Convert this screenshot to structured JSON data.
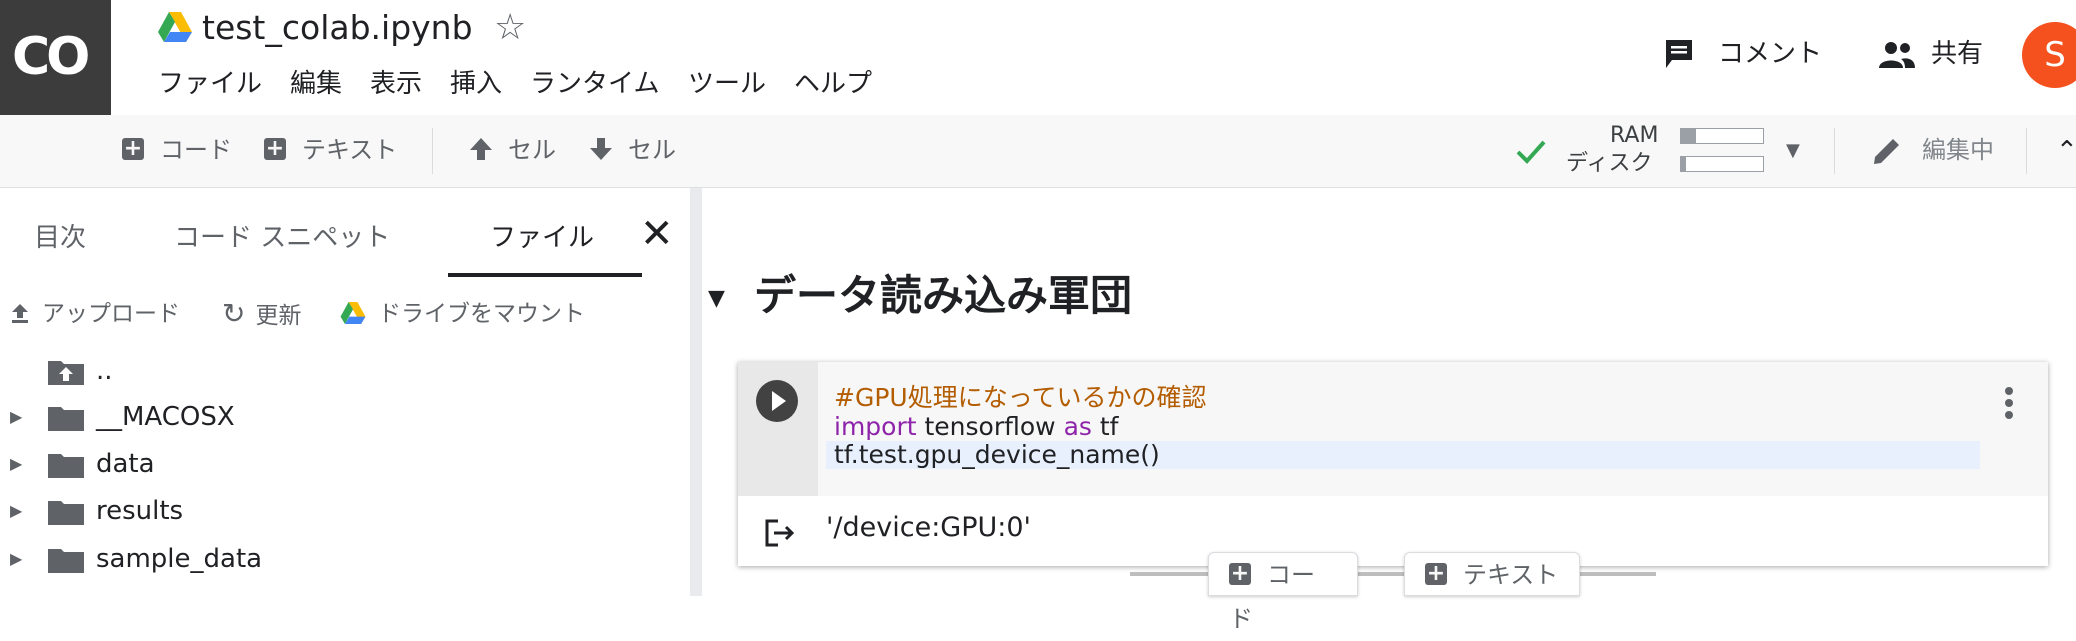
{
  "app": {
    "logo_text": "CO",
    "doc_title": "test_colab.ipynb",
    "star_icon": "star-outline-icon",
    "avatar_initial": "S",
    "avatar_color": "#f4511e"
  },
  "menu": [
    "ファイル",
    "編集",
    "表示",
    "挿入",
    "ランタイム",
    "ツール",
    "ヘルプ"
  ],
  "header_actions": {
    "comment": "コメント",
    "share": "共有"
  },
  "toolbar": {
    "add_code": "コード",
    "add_text": "テキスト",
    "cell_up": "セル",
    "cell_down": "セル",
    "ram_label": "RAM",
    "disk_label": "ディスク",
    "ram_usage": 0.18,
    "disk_usage": 0.06,
    "editing_label": "編集中"
  },
  "sidebar": {
    "tabs": [
      "目次",
      "コード スニペット",
      "ファイル"
    ],
    "active_tab": "ファイル",
    "actions": {
      "upload": "アップロード",
      "refresh": "更新",
      "mount_drive": "ドライブをマウント"
    },
    "files": [
      {
        "name": "..",
        "type": "parent"
      },
      {
        "name": "__MACOSX",
        "type": "folder"
      },
      {
        "name": "data",
        "type": "folder"
      },
      {
        "name": "results",
        "type": "folder"
      },
      {
        "name": "sample_data",
        "type": "folder"
      }
    ]
  },
  "notebook": {
    "section_title": "データ読み込み軍団",
    "cell": {
      "comment": "#GPU処理になっているかの確認",
      "line2_kw1": "import",
      "line2_mid": " tensorflow ",
      "line2_kw2": "as",
      "line2_end": " tf",
      "line3": "tf.test.gpu_device_name()",
      "output": "'/device:GPU:0'"
    },
    "add_bar": {
      "code": "コード",
      "text": "テキスト"
    }
  },
  "colors": {
    "accent_check": "#34a853",
    "comment": "#b35c00",
    "keyword": "#8e24aa",
    "logo_bg": "#3c3c3c"
  }
}
